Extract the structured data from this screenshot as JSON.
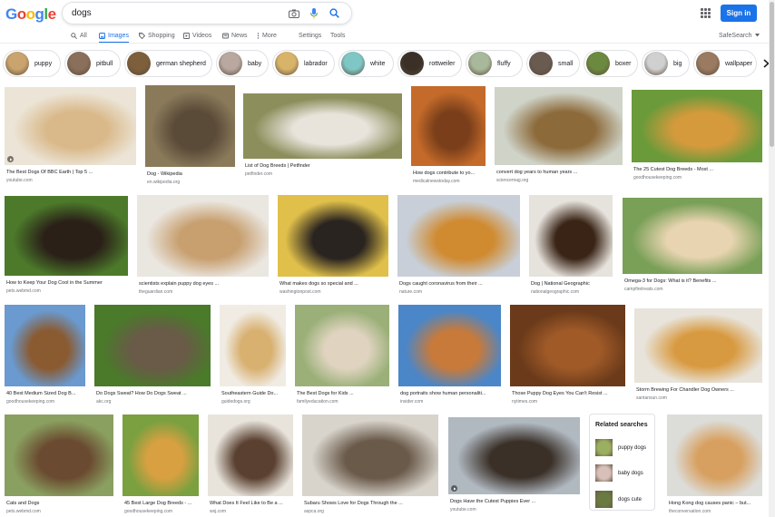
{
  "header": {
    "logo": {
      "letters": [
        "G",
        "o",
        "o",
        "g",
        "l",
        "e"
      ],
      "colors": [
        "#4285f4",
        "#ea4335",
        "#fbbc05",
        "#4285f4",
        "#34a853",
        "#ea4335"
      ]
    },
    "search": {
      "value": "dogs",
      "placeholder": ""
    },
    "icons": [
      "camera-icon",
      "microphone-icon",
      "search-icon",
      "apps-icon"
    ],
    "signin_label": "Sign in",
    "accent": "#1a73e8"
  },
  "tabs": [
    {
      "label": "All",
      "icon": "search-icon"
    },
    {
      "label": "Images",
      "icon": "image-icon",
      "active": true
    },
    {
      "label": "Shopping",
      "icon": "tag-icon"
    },
    {
      "label": "Videos",
      "icon": "play-icon"
    },
    {
      "label": "News",
      "icon": "news-icon"
    },
    {
      "label": "More",
      "icon": "more-icon"
    },
    {
      "label": "Settings"
    },
    {
      "label": "Tools"
    }
  ],
  "safesearch_label": "SafeSearch",
  "chips": [
    {
      "label": "puppy",
      "color": "#c9a46e"
    },
    {
      "label": "pitbull",
      "color": "#8a6f5a"
    },
    {
      "label": "german shepherd",
      "color": "#7d5f3c"
    },
    {
      "label": "baby",
      "color": "#b8a8a0"
    },
    {
      "label": "labrador",
      "color": "#d8b36a"
    },
    {
      "label": "white",
      "color": "#7fc7c5"
    },
    {
      "label": "rottweiler",
      "color": "#3a3028"
    },
    {
      "label": "fluffy",
      "color": "#a8b89a"
    },
    {
      "label": "small",
      "color": "#6a5b50"
    },
    {
      "label": "boxer",
      "color": "#6b8a40"
    },
    {
      "label": "big",
      "color": "#d0d0d0"
    },
    {
      "label": "wallpaper",
      "color": "#9a7a60"
    }
  ],
  "results": [
    {
      "title": "The Best Dogs Of BBC Earth | Top 5 ...",
      "source": "youtube.com",
      "colors": [
        "#ece4d6",
        "#d9b98a"
      ],
      "video": true
    },
    {
      "title": "Dog - Wikipedia",
      "source": "en.wikipedia.org",
      "colors": [
        "#8a7a5a",
        "#5a4a38"
      ]
    },
    {
      "title": "List of Dog Breeds | Petfinder",
      "source": "petfinder.com",
      "colors": [
        "#8c8f5c",
        "#e8e4dc"
      ]
    },
    {
      "title": "How dogs contribute to yo...",
      "source": "medicalnewstoday.com",
      "colors": [
        "#c46a2a",
        "#7a3f1a"
      ]
    },
    {
      "title": "convert dog years to human years ...",
      "source": "sciencemag.org",
      "colors": [
        "#cfd3c8",
        "#8c6a3a"
      ]
    },
    {
      "title": "The 25 Cutest Dog Breeds - Most ...",
      "source": "goodhousekeeping.com",
      "colors": [
        "#6a9a3a",
        "#d49a3c"
      ]
    },
    {
      "title": "How to Keep Your Dog Cool in the Summer",
      "source": "pets.webmd.com",
      "colors": [
        "#4c7a2a",
        "#2a2018"
      ]
    },
    {
      "title": "scientists explain puppy dog eyes ...",
      "source": "theguardian.com",
      "colors": [
        "#eae6e0",
        "#c8a070"
      ]
    },
    {
      "title": "What makes dogs so special and ...",
      "source": "washingtonpost.com",
      "colors": [
        "#e0c04a",
        "#2a2420"
      ]
    },
    {
      "title": "Dogs caught coronavirus from their ...",
      "source": "nature.com",
      "colors": [
        "#c8cfd8",
        "#d08a30"
      ]
    },
    {
      "title": "Dog | National Geographic",
      "source": "nationalgeographic.com",
      "colors": [
        "#e6e2dc",
        "#3a2416"
      ]
    },
    {
      "title": "Omega-3 for Dogs: What is it? Benefits ...",
      "source": "campfiretreats.com",
      "colors": [
        "#7aa058",
        "#e8d4b0"
      ]
    },
    {
      "title": "40 Best Medium Sized Dog B...",
      "source": "goodhousekeeping.com",
      "colors": [
        "#6a9ad0",
        "#8a5a30"
      ]
    },
    {
      "title": "Do Dogs Sweat? How Do Dogs Sweat ...",
      "source": "akc.org",
      "colors": [
        "#4a7a2a",
        "#6a5a48"
      ]
    },
    {
      "title": "Southeastern Guide Do...",
      "source": "guidedogs.org",
      "colors": [
        "#f0ece4",
        "#d8b070"
      ]
    },
    {
      "title": "The Best Dogs for Kids ...",
      "source": "familyeducation.com",
      "colors": [
        "#9ab078",
        "#e0d4c0"
      ]
    },
    {
      "title": "dog portraits show human personaliti...",
      "source": "insider.com",
      "colors": [
        "#4a86c8",
        "#c87a3a"
      ]
    },
    {
      "title": "Those Puppy Dog Eyes You Can't Resist ...",
      "source": "nytimes.com",
      "colors": [
        "#6a3a1a",
        "#a05a28"
      ]
    },
    {
      "title": "Storm Brewing For Chandler Dog Owners ...",
      "source": "santansun.com",
      "colors": [
        "#e8e4dc",
        "#d89a40"
      ]
    },
    {
      "title": "Cats and Dogs",
      "source": "pets.webmd.com",
      "colors": [
        "#8aa060",
        "#6a4a30"
      ]
    },
    {
      "title": "45 Best Large Dog Breeds - ...",
      "source": "goodhousekeeping.com",
      "colors": [
        "#7aa040",
        "#d8a040"
      ]
    },
    {
      "title": "What Does It Feel Like to Be a ...",
      "source": "wsj.com",
      "colors": [
        "#e8e4dc",
        "#5a4030"
      ]
    },
    {
      "title": "Subaru Shows Love for Dogs Through the ...",
      "source": "aspca.org",
      "colors": [
        "#d8d4cc",
        "#6a5a4a"
      ]
    },
    {
      "title": "Dogs Have the Cutest Puppies Ever ...",
      "source": "youtube.com",
      "colors": [
        "#b0b8c0",
        "#3a3028"
      ],
      "video": true
    },
    {
      "title": "Hong Kong dog causes panic – but...",
      "source": "theconversation.com",
      "colors": [
        "#dcdcd8",
        "#d8a060"
      ]
    }
  ],
  "related": {
    "heading": "Related searches",
    "items": [
      {
        "label": "puppy dogs",
        "color": "#9ab060"
      },
      {
        "label": "baby dogs",
        "color": "#d8c0b8"
      },
      {
        "label": "dogs cute",
        "color": "#6a7a40"
      }
    ]
  }
}
